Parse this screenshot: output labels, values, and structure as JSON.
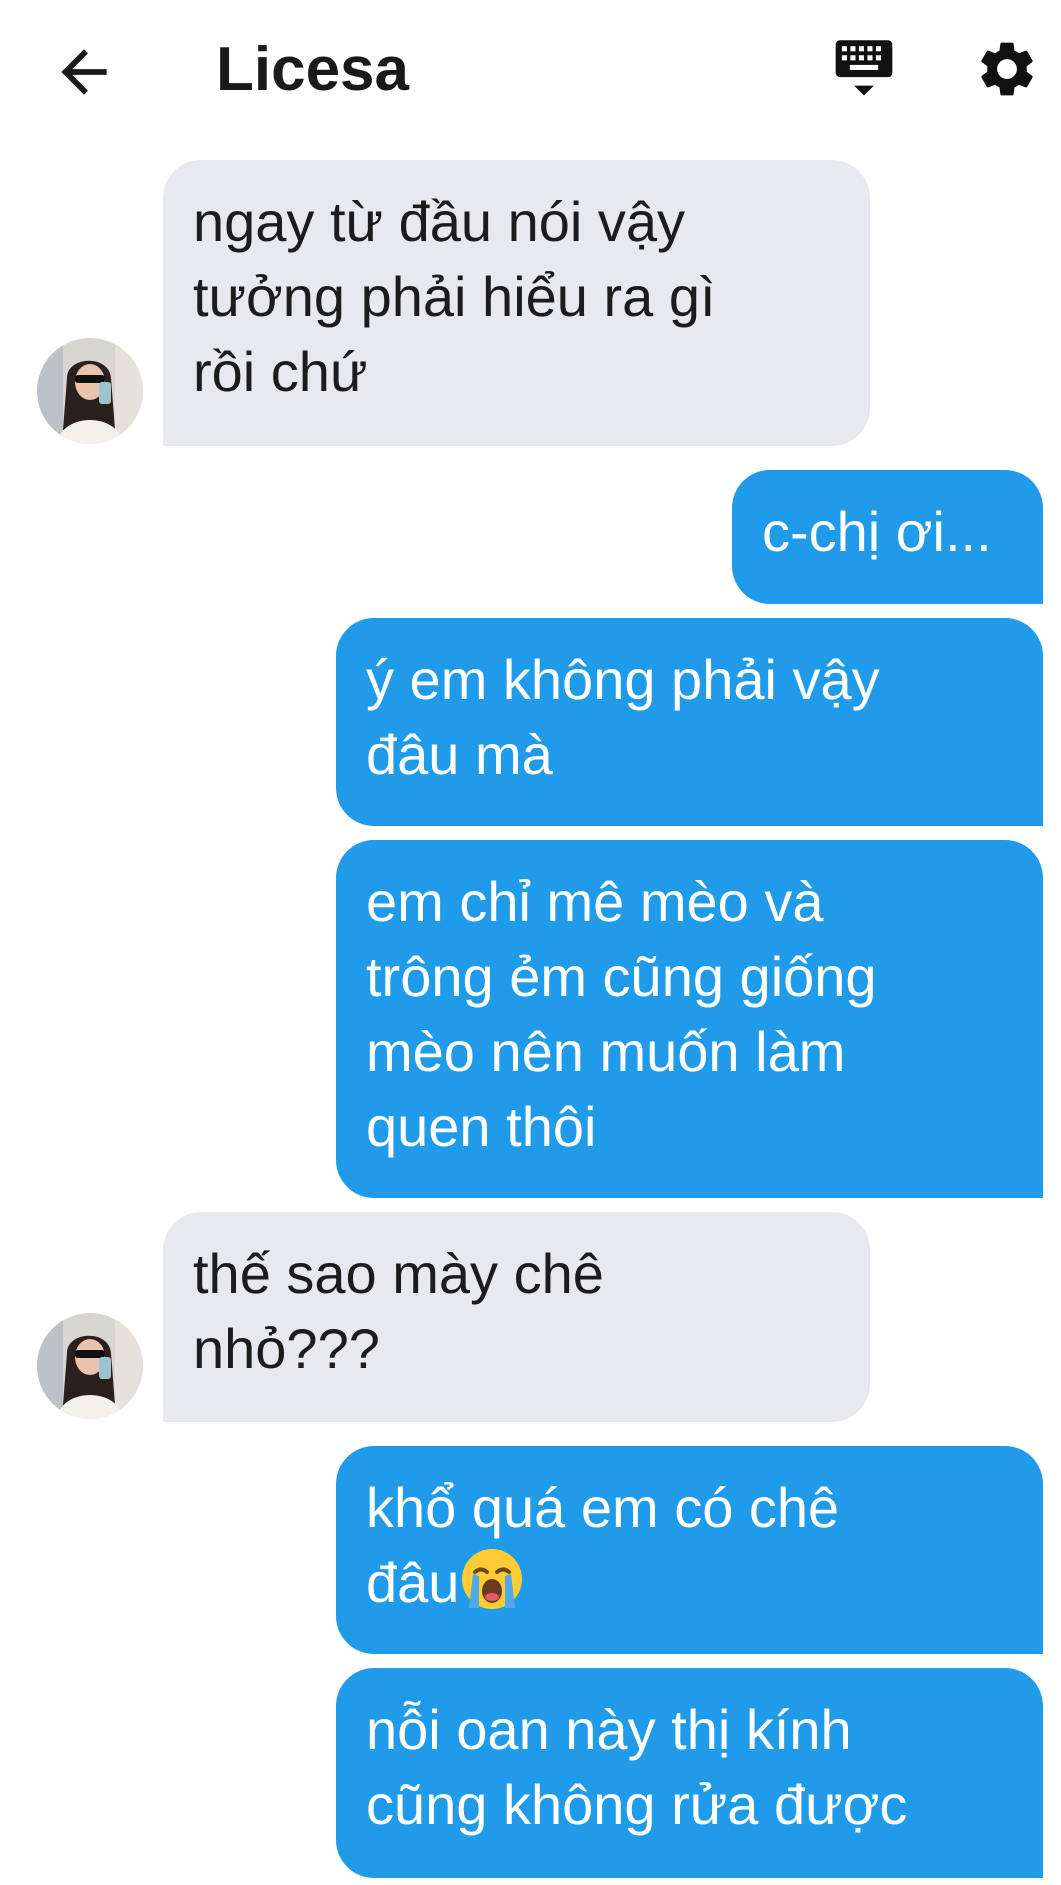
{
  "header": {
    "title": "Licesa",
    "back_icon": "arrow-left-icon",
    "keyboard_icon": "keyboard-icon",
    "settings_icon": "gear-icon"
  },
  "colors": {
    "incoming_bubble": "#e7e9ee",
    "outgoing_bubble": "#1f9be9",
    "outgoing_text": "#ffffff",
    "incoming_text": "#1c1c1c"
  },
  "messages": [
    {
      "direction": "incoming",
      "text": "ngay từ đầu nói vậy\ntưởng phải hiểu ra gì\nrồi chứ"
    },
    {
      "direction": "outgoing",
      "text": "c-chị ơi..."
    },
    {
      "direction": "outgoing",
      "text": "ý em không phải vậy\nđâu mà"
    },
    {
      "direction": "outgoing",
      "text": "em chỉ mê mèo và\ntrông ẻm cũng giống\nmèo nên muốn làm\nquen thôi"
    },
    {
      "direction": "incoming",
      "text": "thế sao mày chê\nnhỏ???"
    },
    {
      "direction": "outgoing",
      "text": "khổ quá em có chê\nđâu",
      "emoji": "loudly-crying-face-icon"
    },
    {
      "direction": "outgoing",
      "text": "nỗi oan này thị kính\ncũng không rửa được"
    }
  ]
}
